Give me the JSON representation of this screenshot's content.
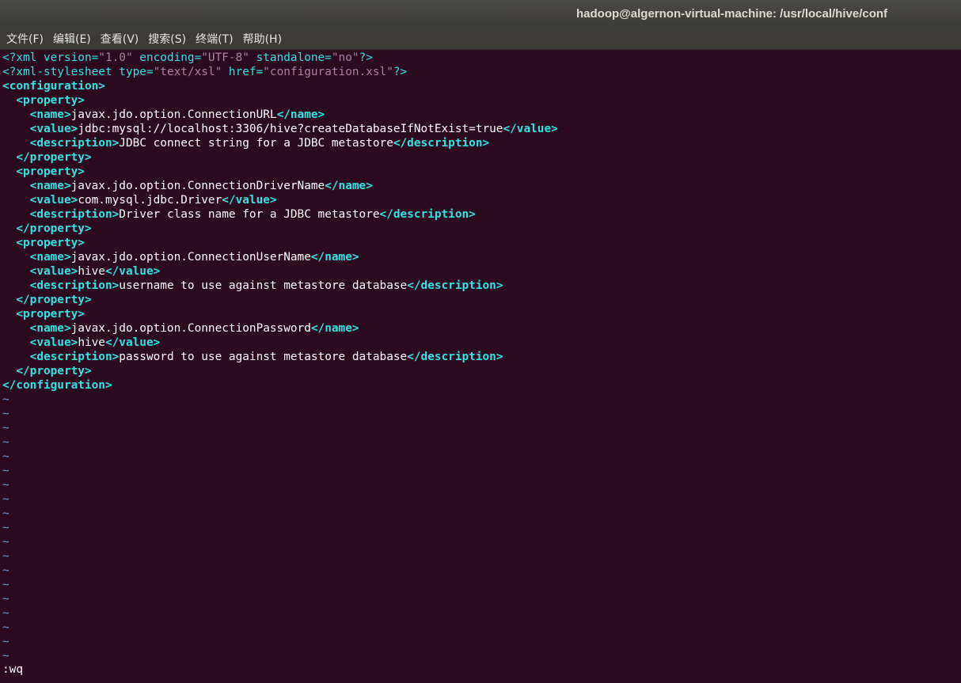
{
  "window": {
    "title": "hadoop@algernon-virtual-machine: /usr/local/hive/conf"
  },
  "menu": [
    "文件(F)",
    "编辑(E)",
    "查看(V)",
    "搜索(S)",
    "终端(T)",
    "帮助(H)"
  ],
  "editor": {
    "xml_decl": {
      "open": "<?xml ",
      "version_attr": "version=",
      "version_val": "\"1.0\"",
      "encoding_attr": " encoding=",
      "encoding_val": "\"UTF-8\"",
      "standalone_attr": " standalone=",
      "standalone_val": "\"no\"",
      "close": "?>"
    },
    "stylesheet_decl": {
      "open": "<?xml-stylesheet ",
      "type_attr": "type=",
      "type_val": "\"text/xsl\"",
      "href_attr": " href=",
      "href_val": "\"configuration.xsl\"",
      "close": "?>"
    },
    "root_open": "<configuration>",
    "root_close": "</configuration>",
    "property_open": "<property>",
    "property_close": "</property>",
    "name_open": "<name>",
    "name_close": "</name>",
    "value_open": "<value>",
    "value_close": "</value>",
    "description_open": "<description>",
    "description_close": "</description>",
    "properties": [
      {
        "name": "javax.jdo.option.ConnectionURL",
        "value": "jdbc:mysql://localhost:3306/hive?createDatabaseIfNotExist=true",
        "description": "JDBC connect string for a JDBC metastore"
      },
      {
        "name": "javax.jdo.option.ConnectionDriverName",
        "value": "com.mysql.jdbc.Driver",
        "description": "Driver class name for a JDBC metastore"
      },
      {
        "name": "javax.jdo.option.ConnectionUserName",
        "value": "hive",
        "description": "username to use against metastore database"
      },
      {
        "name": "javax.jdo.option.ConnectionPassword",
        "value": "hive",
        "description": "password to use against metastore database"
      }
    ],
    "empty_line_marker": "~",
    "empty_line_count": 19
  },
  "command_line": ":wq",
  "colors": {
    "background": "#2c0a1f",
    "tag": "#34e2e2",
    "string": "#ad7fa8",
    "tilde": "#729fcf",
    "text": "#ffffff"
  }
}
